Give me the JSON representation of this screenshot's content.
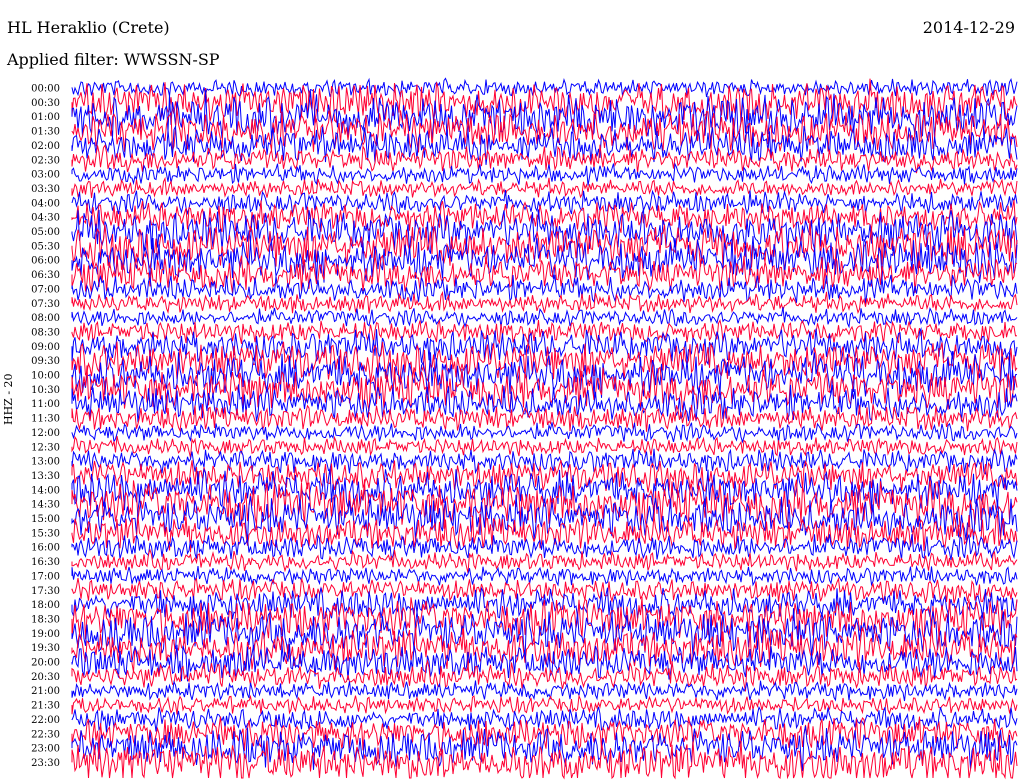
{
  "header": {
    "station": "HL Heraklio (Crete)",
    "date": "2014-12-29",
    "filter": "Applied filter: WWSSN-SP",
    "channel": "HHZ - 20"
  },
  "colors": {
    "primary_trace": "#0000ff",
    "secondary_trace": "#ff0033"
  },
  "chart_data": {
    "type": "line",
    "title": "HL Heraklio (Crete)",
    "subtitle": "Applied filter: WWSSN-SP",
    "date": "2014-12-29",
    "ylabel": "HHZ - 20",
    "xlabel": "",
    "row_labels": [
      "00:00",
      "00:30",
      "01:00",
      "01:30",
      "02:00",
      "02:30",
      "03:00",
      "03:30",
      "04:00",
      "04:30",
      "05:00",
      "05:30",
      "06:00",
      "06:30",
      "07:00",
      "07:30",
      "08:00",
      "08:30",
      "09:00",
      "09:30",
      "10:00",
      "10:30",
      "11:00",
      "11:30",
      "12:00",
      "12:30",
      "13:00",
      "13:30",
      "14:00",
      "14:30",
      "15:00",
      "15:30",
      "16:00",
      "16:30",
      "17:00",
      "17:30",
      "18:00",
      "18:30",
      "19:00",
      "19:30",
      "20:00",
      "20:30",
      "21:00",
      "21:30",
      "22:00",
      "22:30",
      "23:00",
      "23:30"
    ],
    "series": [
      {
        "color": "#0000ff",
        "rows": "even (00:00, 01:00, ...)"
      },
      {
        "color": "#ff0033",
        "rows": "odd (00:30, 01:30, ...)"
      }
    ],
    "grid": false
  }
}
